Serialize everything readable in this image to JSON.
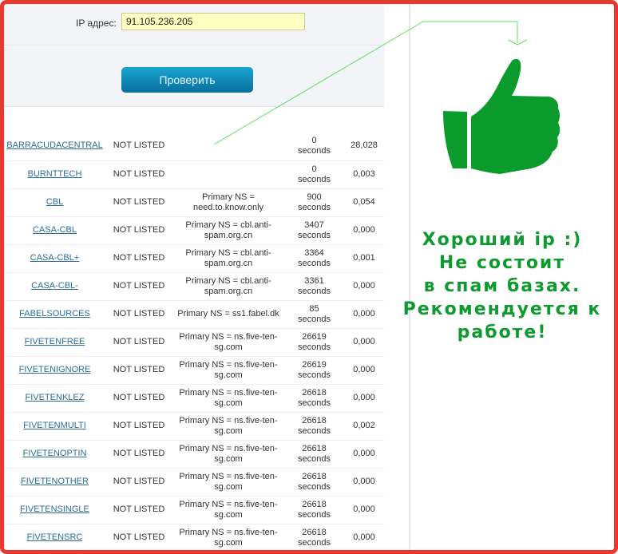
{
  "form": {
    "ip_label": "IP адрес:",
    "ip_value": "91.105.236.205",
    "check_button": "Проверить"
  },
  "results": [
    {
      "list": "BARRACUDACENTRAL",
      "status": "NOT LISTED",
      "info": "",
      "ttl": "0",
      "ttl_unit": "seconds",
      "time": "28,028"
    },
    {
      "list": "BURNTTECH",
      "status": "NOT LISTED",
      "info": "",
      "ttl": "0",
      "ttl_unit": "seconds",
      "time": "0,003"
    },
    {
      "list": "CBL",
      "status": "NOT LISTED",
      "info": "Primary NS = need.to.know.only",
      "ttl": "900",
      "ttl_unit": "seconds",
      "time": "0,054"
    },
    {
      "list": "CASA-CBL",
      "status": "NOT LISTED",
      "info": "Primary NS = cbl.anti-spam.org.cn",
      "ttl": "3407",
      "ttl_unit": "seconds",
      "time": "0,000"
    },
    {
      "list": "CASA-CBL+",
      "status": "NOT LISTED",
      "info": "Primary NS = cbl.anti-spam.org.cn",
      "ttl": "3364",
      "ttl_unit": "seconds",
      "time": "0,001"
    },
    {
      "list": "CASA-CBL-",
      "status": "NOT LISTED",
      "info": "Primary NS = cbl.anti-spam.org.cn",
      "ttl": "3361",
      "ttl_unit": "seconds",
      "time": "0,000"
    },
    {
      "list": "FABELSOURCES",
      "status": "NOT LISTED",
      "info": "Primary NS = ss1.fabel.dk",
      "ttl": "85",
      "ttl_unit": "seconds",
      "time": "0,000"
    },
    {
      "list": "FIVETENFREE",
      "status": "NOT LISTED",
      "info": "Primary NS = ns.five-ten-sg.com",
      "ttl": "26619",
      "ttl_unit": "seconds",
      "time": "0,000"
    },
    {
      "list": "FIVETENIGNORE",
      "status": "NOT LISTED",
      "info": "Primary NS = ns.five-ten-sg.com",
      "ttl": "26619",
      "ttl_unit": "seconds",
      "time": "0,000"
    },
    {
      "list": "FIVETENKLEZ",
      "status": "NOT LISTED",
      "info": "Primary NS = ns.five-ten-sg.com",
      "ttl": "26618",
      "ttl_unit": "seconds",
      "time": "0,000"
    },
    {
      "list": "FIVETENMULTI",
      "status": "NOT LISTED",
      "info": "Primary NS = ns.five-ten-sg.com",
      "ttl": "26618",
      "ttl_unit": "seconds",
      "time": "0,002"
    },
    {
      "list": "FIVETENOPTIN",
      "status": "NOT LISTED",
      "info": "Primary NS = ns.five-ten-sg.com",
      "ttl": "26618",
      "ttl_unit": "seconds",
      "time": "0,000"
    },
    {
      "list": "FIVETENOTHER",
      "status": "NOT LISTED",
      "info": "Primary NS = ns.five-ten-sg.com",
      "ttl": "26618",
      "ttl_unit": "seconds",
      "time": "0,000"
    },
    {
      "list": "FIVETENSINGLE",
      "status": "NOT LISTED",
      "info": "Primary NS = ns.five-ten-sg.com",
      "ttl": "26618",
      "ttl_unit": "seconds",
      "time": "0,000"
    },
    {
      "list": "FIVETENSRC",
      "status": "NOT LISTED",
      "info": "Primary NS = ns.five-ten-sg.com",
      "ttl": "26618",
      "ttl_unit": "seconds",
      "time": "0,000"
    }
  ],
  "annotation": {
    "icon": "thumbs-up-icon",
    "lines": [
      "Хороший ip :)",
      "Не состоит",
      "в спам базах.",
      "Рекомендуется к",
      "работе!"
    ],
    "color": "#0d9a2f",
    "frame_color": "#e8392f",
    "arrow_color": "#5ce05c"
  }
}
